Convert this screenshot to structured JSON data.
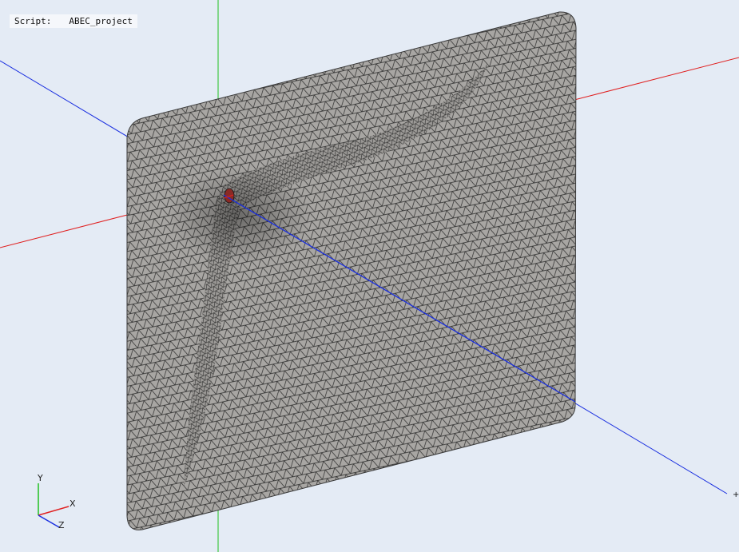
{
  "script_panel": {
    "label": "Script:",
    "value": "ABEC_project"
  },
  "axis_triad": {
    "x": "X",
    "y": "Y",
    "z": "Z"
  },
  "colors": {
    "background": "#e4ebf5",
    "x_axis": "#e02020",
    "y_axis": "#20c020",
    "z_axis": "#1a2fe0",
    "mesh_fill": "#a8a6a3",
    "mesh_edge": "#2a2a2a"
  }
}
